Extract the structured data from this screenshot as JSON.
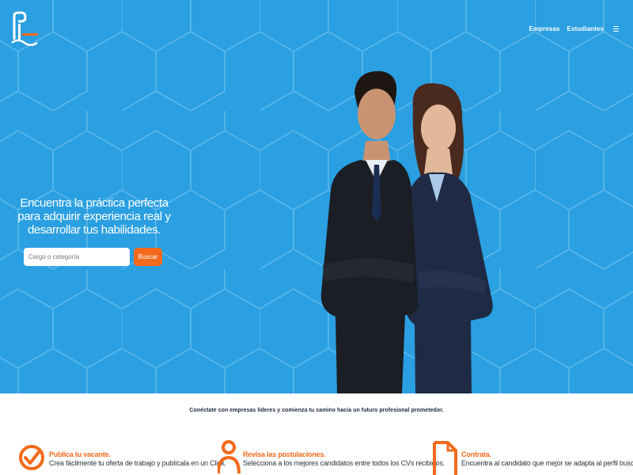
{
  "header": {
    "logo_icon": "prometedor-logo-icon",
    "nav": [
      {
        "label": "Empresas"
      },
      {
        "label": "Estudiantes"
      }
    ],
    "menu_icon": "hamburger-menu-icon"
  },
  "hero": {
    "background_color": "#2a9fe1",
    "headline": "Encuentra la práctica perfecta para adquirir experiencia real y desarrollar tus habilidades.",
    "search": {
      "placeholder": "Cargo o categoría",
      "value": "",
      "button_label": "Buscar"
    },
    "image": "two-professionals-photo"
  },
  "tagline": "Conéctate con empresas líderes y comienza tu camino hacia un futuro profesional prometedor.",
  "features": [
    {
      "icon": "check-circle-icon",
      "title": "Publica tu vacante.",
      "description": "Crea fácilmente tu oferta de trabajo y publícala en un Click."
    },
    {
      "icon": "person-icon",
      "title": "Revisa las postulaciones.",
      "description": "Selecciona a los mejores candidatos entre todos los CVs recibidos."
    },
    {
      "icon": "document-icon",
      "title": "Contrata.",
      "description": "Encuentra al candidato que mejor se adapta al perfil buscado."
    }
  ],
  "colors": {
    "accent": "#f26a1b",
    "hero_blue": "#2a9fe1"
  }
}
